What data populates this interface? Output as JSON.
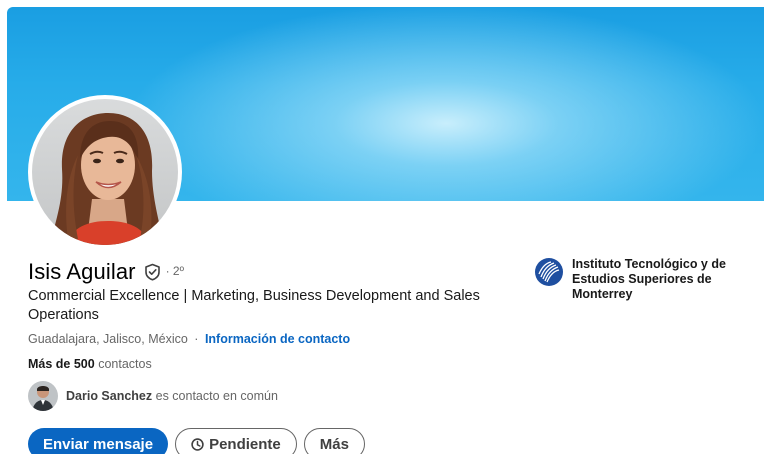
{
  "profile": {
    "name": "Isis Aguilar",
    "degree": "· 2º",
    "headline": "Commercial Excellence | Marketing, Business Development and Sales Operations",
    "location": "Guadalajara, Jalisco, México",
    "location_separator": "·",
    "contact_info_link": "Información de contacto",
    "connections_count": "Más de 500",
    "connections_label": "contactos"
  },
  "mutual": {
    "name": "Dario Sanchez",
    "text": "es contacto en común"
  },
  "actions": {
    "message_label": "Enviar mensaje",
    "pending_label": "Pendiente",
    "more_label": "Más"
  },
  "education": {
    "school_name": "Instituto Tecnológico y de Estudios Superiores de Monterrey"
  },
  "icons": {
    "verified": "verified-shield-icon",
    "pending": "clock-icon",
    "school_logo": "school-logo-icon"
  },
  "colors": {
    "primary": "#0a66c2",
    "banner": "#27ace9",
    "text_secondary": "#666666"
  }
}
